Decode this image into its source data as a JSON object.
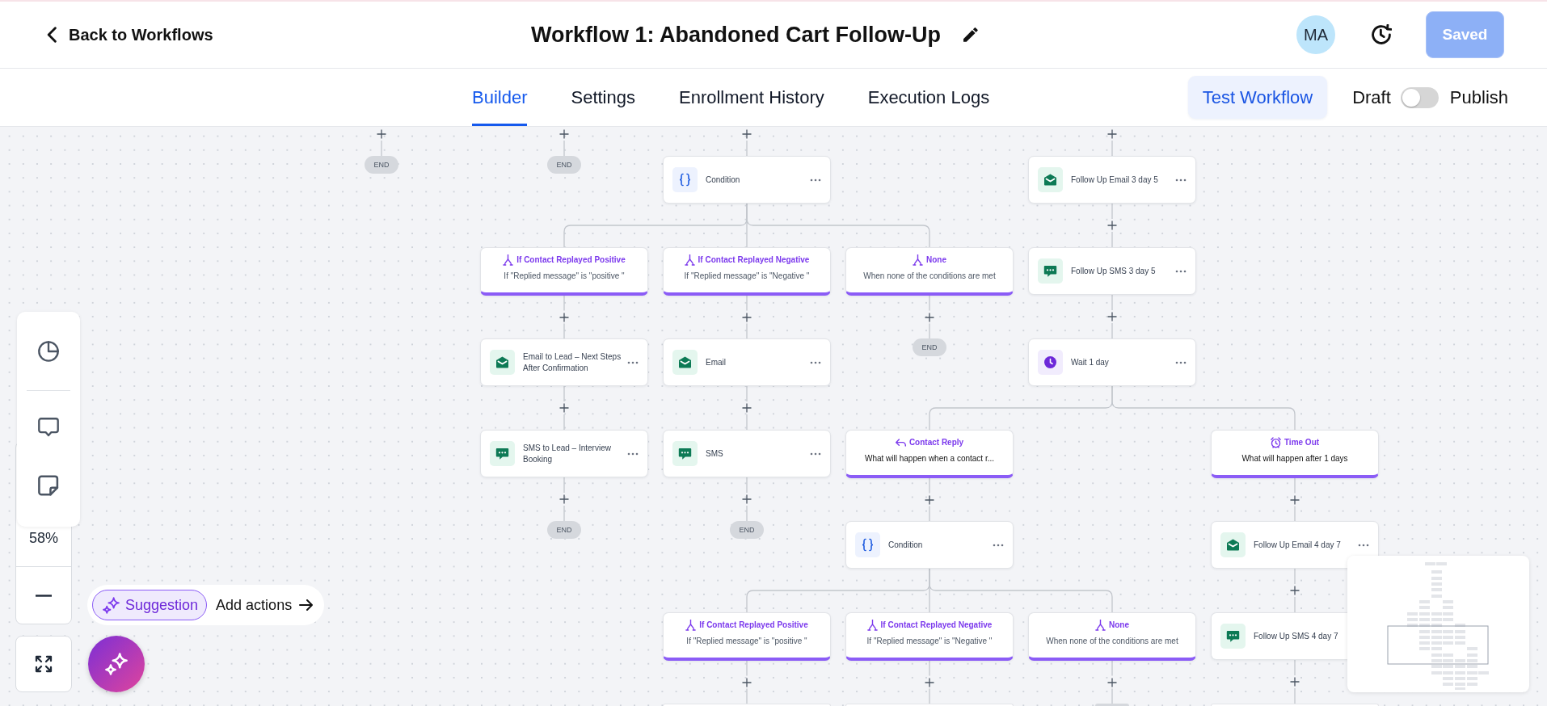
{
  "header": {
    "back_label": "Back to Workflows",
    "title": "Workflow 1: Abandoned Cart Follow-Up",
    "avatar_initials": "MA",
    "save_button": {
      "label": "Saved",
      "disabled": true
    }
  },
  "tabs": [
    {
      "label": "Builder",
      "selected": true
    },
    {
      "label": "Settings",
      "selected": false
    },
    {
      "label": "Enrollment History",
      "selected": false
    },
    {
      "label": "Execution Logs",
      "selected": false
    }
  ],
  "test_button": "Test Workflow",
  "publish_toggle": {
    "off_label": "Draft",
    "on_label": "Publish",
    "on": false
  },
  "canvas": {
    "flows": [
      {
        "steps": [
          {
            "kind": "end",
            "label": "END"
          }
        ]
      },
      {
        "steps": [
          {
            "kind": "end",
            "label": "END"
          }
        ]
      },
      {
        "steps": [
          {
            "kind": "condition",
            "label": "Condition",
            "menu": true,
            "branches": [
              {
                "kind": "split",
                "title": "If Contact Replayed Positive",
                "subtitle": "If \"Replied message\" is \"positive \"",
                "steps": [
                  {
                    "kind": "email",
                    "label": "Email to Lead – Next Steps After Confirmation",
                    "menu": true
                  },
                  {
                    "kind": "sms",
                    "label": "SMS to Lead – Interview Booking",
                    "menu": true
                  },
                  {
                    "kind": "end",
                    "label": "END"
                  }
                ]
              },
              {
                "kind": "split",
                "title": "If Contact Replayed Negative",
                "subtitle": "If \"Replied message\" is \"Negative \"",
                "steps": [
                  {
                    "kind": "email",
                    "label": "Email",
                    "menu": true
                  },
                  {
                    "kind": "sms",
                    "label": "SMS",
                    "menu": true
                  },
                  {
                    "kind": "end",
                    "label": "END"
                  }
                ]
              },
              {
                "kind": "split",
                "title": "None",
                "subtitle": "When none of the conditions are met",
                "steps": [
                  {
                    "kind": "end",
                    "label": "END"
                  }
                ]
              }
            ]
          }
        ]
      },
      {
        "steps": [
          {
            "kind": "email",
            "label": "Follow Up Email 3 day 5",
            "menu": true
          },
          {
            "kind": "sms",
            "label": "Follow Up SMS 3 day 5",
            "menu": true
          },
          {
            "kind": "wait",
            "label": "Wait 1 day",
            "menu": true,
            "branches": [
              {
                "kind": "reply",
                "title": "Contact Reply",
                "subtitle": "What will happen when a contact r...",
                "steps": [
                  {
                    "kind": "condition",
                    "label": "Condition",
                    "menu": true,
                    "branches": [
                      {
                        "kind": "split",
                        "title": "If Contact Replayed Positive",
                        "subtitle": "If \"Replied message\" is \"positive \"",
                        "steps": [
                          {
                            "kind": "stub"
                          }
                        ]
                      },
                      {
                        "kind": "split",
                        "title": "If Contact Replayed Negative",
                        "subtitle": "If \"Replied message\" is \"Negative \"",
                        "steps": [
                          {
                            "kind": "stub"
                          }
                        ]
                      },
                      {
                        "kind": "split",
                        "title": "None",
                        "subtitle": "When none of the conditions are met",
                        "steps": [
                          {
                            "kind": "end_stub"
                          }
                        ]
                      }
                    ]
                  }
                ]
              },
              {
                "kind": "timeout",
                "title": "Time Out",
                "subtitle": "What will happen after 1 days",
                "steps": [
                  {
                    "kind": "email",
                    "label": "Follow Up Email 4 day 7",
                    "menu": true
                  },
                  {
                    "kind": "sms",
                    "label": "Follow Up SMS 4 day 7",
                    "menu": false
                  },
                  {
                    "kind": "stub"
                  }
                ]
              }
            ]
          }
        ]
      }
    ]
  },
  "toolbar": {
    "zoom_level": "58%"
  },
  "suggestion": {
    "chip": "Suggestion",
    "action": "Add actions"
  }
}
